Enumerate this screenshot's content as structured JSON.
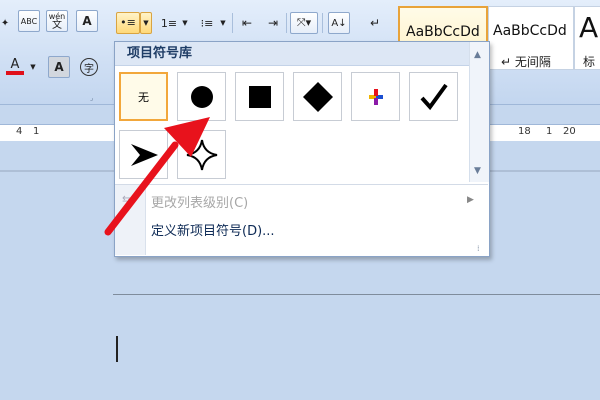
{
  "ribbon": {
    "row1_buttons": [
      "ABC",
      "wén",
      "A"
    ],
    "row1_phonetic_char": "文",
    "row2_buttons": [
      "A",
      "A",
      "字"
    ],
    "font_color_letter": "A",
    "font_color_hex": "#e0101a"
  },
  "styles": [
    {
      "sample": "AaBbCcDd",
      "name": ""
    },
    {
      "sample": "AaBbCcDd",
      "name": "↵ 无间隔"
    },
    {
      "sample": "A",
      "name": "标"
    }
  ],
  "ruler": {
    "ticks": [
      "4",
      "1",
      "18",
      "1",
      "20"
    ]
  },
  "bullet_library": {
    "title": "项目符号库",
    "none_label": "无",
    "symbols": [
      "none",
      "filled-circle",
      "filled-square",
      "filled-diamond",
      "four-color-cross",
      "checkmark",
      "arrowhead",
      "four-point-star"
    ]
  },
  "menu": {
    "change_level": "更改列表级别(C)",
    "define_new": "定义新项目符号(D)..."
  },
  "colors": {
    "annotation_arrow": "#e8121c",
    "selected_border": "#f2a73b"
  }
}
